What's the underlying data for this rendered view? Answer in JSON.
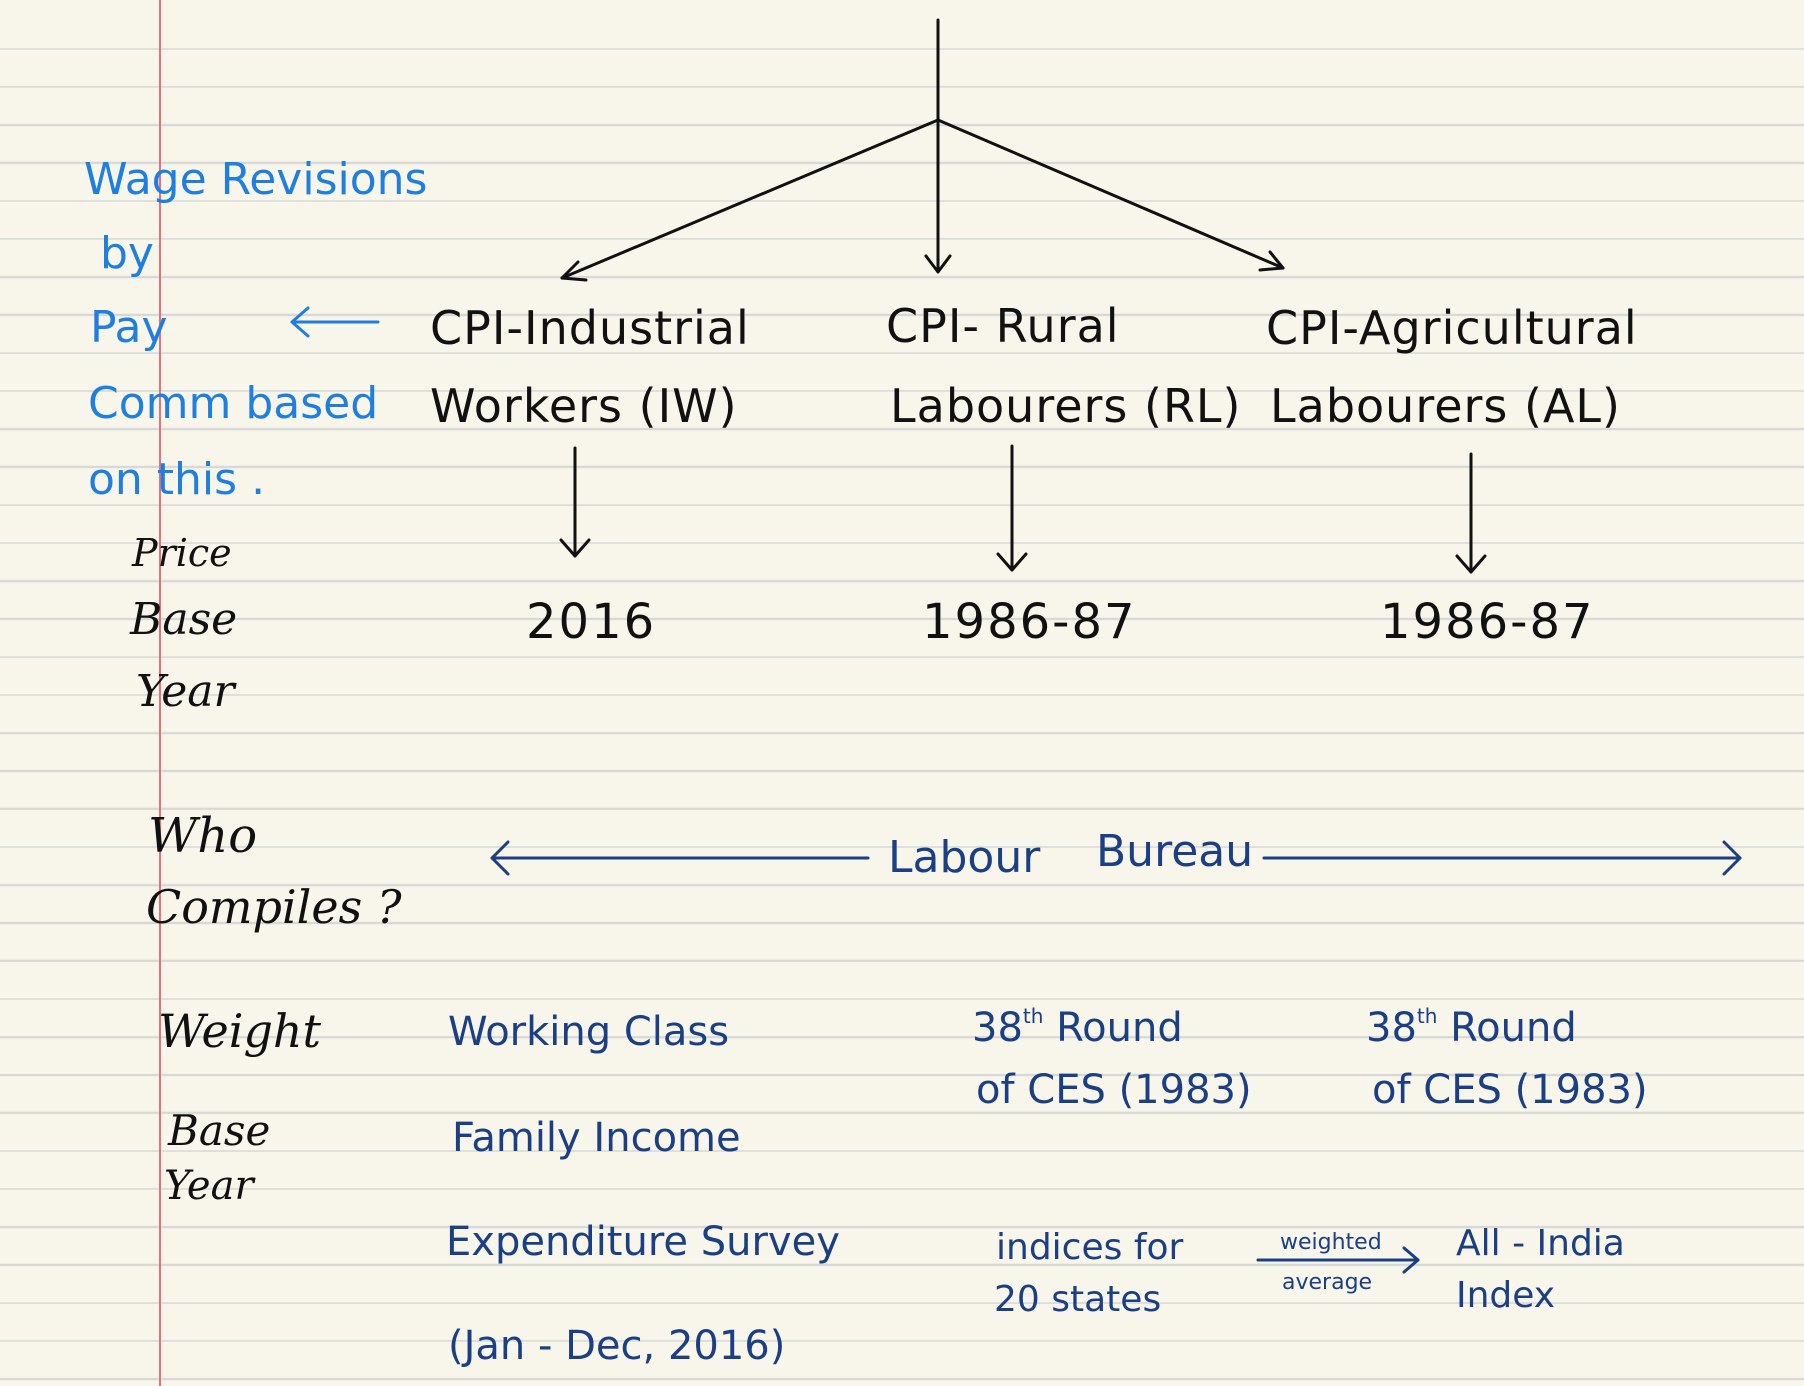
{
  "title_note": {
    "line1": "Wage Revisions",
    "line2": "by",
    "line3": "Pay",
    "line4": "Comm based",
    "line5": "on this ."
  },
  "columns": [
    {
      "name_line1": "CPI-Industrial",
      "name_line2": "Workers (IW)",
      "base_year": "2016",
      "weight_base": [
        "Working Class",
        "Family Income",
        "Expenditure Survey",
        "(Jan - Dec, 2016)"
      ]
    },
    {
      "name_line1": "CPI- Rural",
      "name_line2": "Labourers (RL)",
      "base_year": "1986-87",
      "weight_base_prefix": "38",
      "weight_base_sup": "th",
      "weight_base_suffix": "Round",
      "weight_base_line2": "of CES (1983)"
    },
    {
      "name_line1": "CPI-Agricultural",
      "name_line2": "Labourers (AL)",
      "base_year": "1986-87",
      "weight_base_prefix": "38",
      "weight_base_sup": "th",
      "weight_base_suffix": "Round",
      "weight_base_line2": "of CES (1983)"
    }
  ],
  "row_labels": {
    "price_base_line1": "Price",
    "price_base_line2": "Base",
    "price_base_line3": "Year",
    "who_compiles_line1": "Who",
    "who_compiles_line2": "Compiles ?",
    "weight_base_line1": "Weight",
    "weight_base_line2": "Base",
    "weight_base_line3": "Year"
  },
  "compiler": {
    "label_part1": "Labour",
    "label_part2": "Bureau"
  },
  "aggregation": {
    "indices_line1": "indices for",
    "indices_line2": "20 states",
    "arrow_top_label": "weighted",
    "arrow_bottom_label": "average",
    "result_line1": "All - India",
    "result_line2": "Index"
  },
  "colors": {
    "black_ink": "#111111",
    "blue_ink": "#1f7fe0",
    "navy_ink": "#1b3f85",
    "margin_line": "#e7707a",
    "paper": "#f8f5ea",
    "rule": "#d7d9d7"
  }
}
